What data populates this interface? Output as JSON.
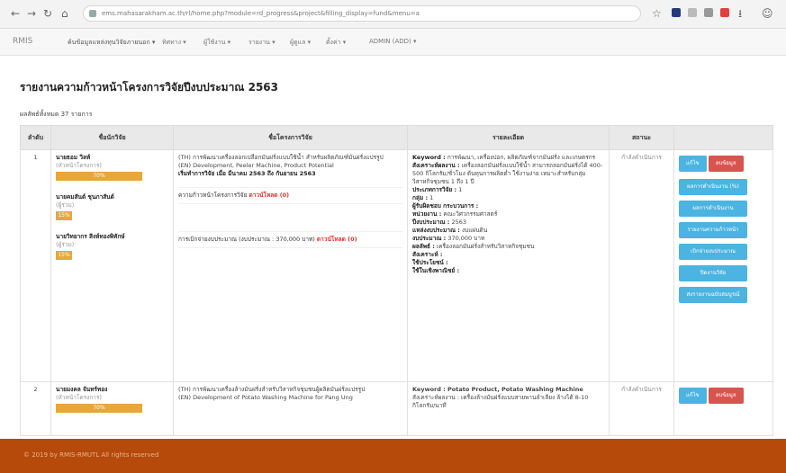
{
  "browser": {
    "url": "ems.mahasarakham.ac.th/rl/home.php?module=rd_progress&project&filling_display=fund&menu=a"
  },
  "app": {
    "brand": "RMIS",
    "menu": [
      "ค้นข้อมูลแหล่งทุนวิจัยภายนอก ▾",
      "ทิศทาง ▾",
      "ผู้ใช้งาน ▾",
      "รายงาน ▾",
      "ผู้ดูแล ▾",
      "ตั้งค่า ▾",
      "ADMIN (ADD) ▾"
    ]
  },
  "page": {
    "title": "รายงานความก้าวหน้าโครงการวิจัยปีงบประมาณ 2563",
    "count": "ผลลัพธ์ทั้งหมด 37 รายการ"
  },
  "table": {
    "headers": [
      "ลำดับ",
      "ชื่อนักวิจัย",
      "ชื่อโครงการวิจัย",
      "รายละเอียด",
      "สถานะ",
      ""
    ],
    "rows": [
      {
        "no": "1",
        "researchers": [
          {
            "name": "นายธอม วิลท์",
            "role": "(หัวหน้าโครงการ)",
            "pct": "70%"
          },
          {
            "name": "นายคมสันต์ ชุนภาสันต์",
            "role": "(ผู้ร่วม)",
            "pct": "15%"
          },
          {
            "name": "นายวิทยากร สิงห์ทองพิทักษ์",
            "role": "(ผู้ร่วม)",
            "pct": "15%"
          }
        ],
        "title_th": "(TH) การพัฒนาเครื่องลอกเปลือกมันฝรั่งแบบใช้น้ำ สำหรับผลิตภัณฑ์มันฝรั่งแปรรูป",
        "title_en": "(EN) Development, Peeler Machine, Product Potential",
        "period": "เริ่มทำการวิจัย เมื่อ มีนาคม 2563 ถึง กันยายน 2563",
        "progress_label": "ความก้าวหน้าโครงการวิจัย",
        "progress_link": "ดาวน์โหลด (0)",
        "budget_label": "การเบิกจ่ายงบประมาณ (งบประมาณ : 370,000 บาท)",
        "budget_link": "ดาวน์โหลด (0)",
        "details": [
          {
            "k": "Keyword :",
            "v": " การพัฒนา, เครื่องปอก, ผลิตภัณฑ์จากมันฝรั่ง และเกษตรกร"
          },
          {
            "k": "สังเคราะห์ผลงาน :",
            "v": " เครื่องลอกมันฝรั่งแบบใช้น้ำ สามารถลอกมันฝรั่งได้ 400-500 กิโลกรัม/ชั่วโมง ต้นทุนการผลิตต่ำ ใช้งานง่าย เหมาะสำหรับกลุ่มวิสาหกิจชุมชน 1 ถึง 1 ปี"
          },
          {
            "k": "ประเภทการวิจัย :",
            "v": " 1"
          },
          {
            "k": "กลุ่ม :",
            "v": " 1"
          },
          {
            "k": "ผู้รับผิดชอบ กระบวนการ :",
            "v": ""
          },
          {
            "k": "หน่วยงาน :",
            "v": " คณะวิศวกรรมศาสตร์"
          },
          {
            "k": "ปีงบประมาณ :",
            "v": " 2563"
          },
          {
            "k": "แหล่งงบประมาณ :",
            "v": " งบแผ่นดิน"
          },
          {
            "k": "งบประมาณ :",
            "v": " 370,000 บาท"
          },
          {
            "k": "ผลลัพธ์ :",
            "v": " เครื่องลอกมันฝรั่งสำหรับวิสาหกิจชุมชน"
          },
          {
            "k": "สังเคราะห์ :",
            "v": ""
          },
          {
            "k": "ใช้ประโยชน์ :",
            "v": ""
          },
          {
            "k": "ใช้ในเชิงพาณิชย์ :",
            "v": ""
          }
        ],
        "status": "กำลังดำเนินการ",
        "buttons": {
          "edit": "แก้ไข",
          "delete": "ลบข้อมูล",
          "b1": "ผลการดำเนินงาน (%)",
          "b2": "ผลการดำเนินงาน",
          "b3": "รายงานความก้าวหน้า",
          "b4": "เบิกจ่ายงบประมาณ",
          "b5": "ปิดงานวิจัย",
          "b6": "ส่งรายงานฉบับสมบูรณ์"
        }
      },
      {
        "no": "2",
        "researchers": [
          {
            "name": "นายมงคล จันทร์ทอง",
            "role": "(หัวหน้าโครงการ)",
            "pct": "70%"
          }
        ],
        "title_th": "(TH) การพัฒนาเครื่องล้างมันฝรั่งสำหรับวิสาหกิจชุมชนผู้ผลิตมันฝรั่งแปรรูป",
        "title_en": "(EN) Development of Potato Washing Machine for Pang Ung",
        "keyword": "Keyword : Potato Product, Potato Washing Machine",
        "detail2": "สังเคราะห์ผลงาน : เครื่องล้างมันฝรั่งแบบสายพานลำเลียง ล้างได้ 8-10 กิโลกรัม/นาที",
        "status": "กำลังดำเนินการ",
        "buttons": {
          "edit": "แก้ไข",
          "delete": "ลบข้อมูล"
        }
      }
    ]
  },
  "footer": {
    "text": "© 2019 by RMIS-RMUTL All rights reserved"
  },
  "colors": {
    "accent": "#4bb4e0",
    "danger": "#d9534f",
    "footer": "#b54a0b",
    "bar": "#e7a73b"
  }
}
